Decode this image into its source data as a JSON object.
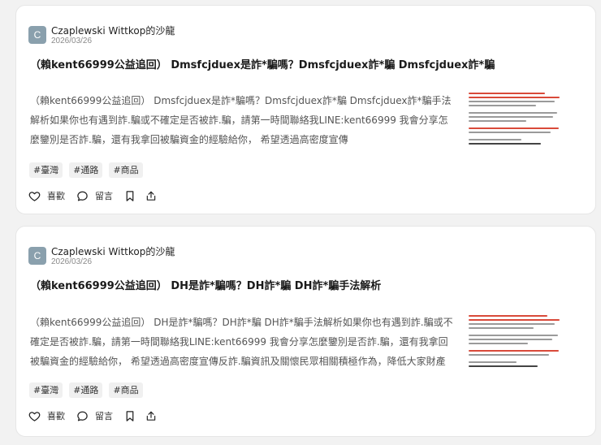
{
  "posts": [
    {
      "avatar_letter": "C",
      "author": "Czaplewski Wittkop的沙龍",
      "date": "2026/03/26",
      "title": "（賴kent66999公益追回） Dmsfcjduex是詐*騙嗎？Dmsfcjduex詐*騙 Dmsfcjduex詐*騙",
      "body": "（賴kent66999公益追回） Dmsfcjduex是詐*騙嗎？Dmsfcjduex詐*騙 Dmsfcjduex詐*騙手法解析如果你也有遇到詐.騙或不確定是否被詐.騙，請第一時間聯絡我LINE:kent66999 我會分享怎麼鑒別是否詐.騙，還有我拿回被騙資金的經驗給你， 希望透過高密度宣傳",
      "tags": [
        "#臺灣",
        "#通路",
        "#商品"
      ],
      "like_label": "喜歡",
      "comment_label": "留言"
    },
    {
      "avatar_letter": "C",
      "author": "Czaplewski Wittkop的沙龍",
      "date": "2026/03/26",
      "title": "（賴kent66999公益追回） DH是詐*騙嗎？DH詐*騙 DH詐*騙手法解析",
      "body": "（賴kent66999公益追回） DH是詐*騙嗎？DH詐*騙 DH詐*騙手法解析如果你也有遇到詐.騙或不確定是否被詐.騙，請第一時間聯絡我LINE:kent66999 我會分享怎麼鑒別是否詐.騙，還有我拿回被騙資金的經驗給你， 希望透過高密度宣傳反詐.騙資訊及關懷民眾相關積極作為，降低大家財產",
      "tags": [
        "#臺灣",
        "#通路",
        "#商品"
      ],
      "like_label": "喜歡",
      "comment_label": "留言"
    }
  ]
}
